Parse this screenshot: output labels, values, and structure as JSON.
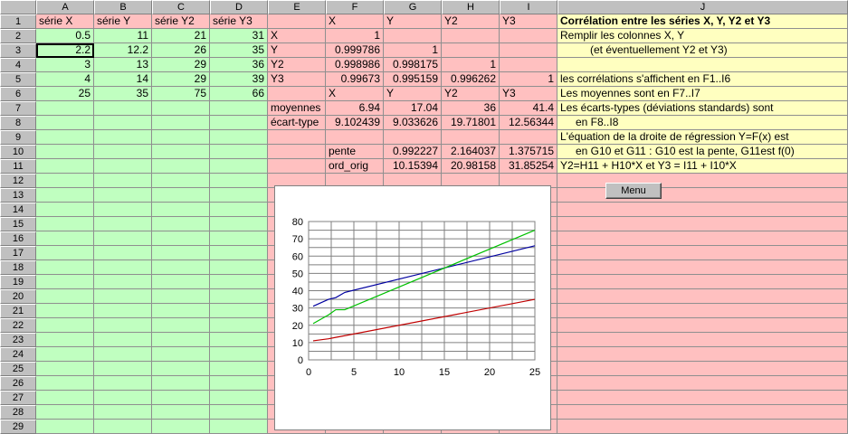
{
  "columns": [
    "A",
    "B",
    "C",
    "D",
    "E",
    "F",
    "G",
    "H",
    "I",
    "J"
  ],
  "rows": [
    "1",
    "2",
    "3",
    "4",
    "5",
    "6",
    "7",
    "8",
    "9",
    "10",
    "11",
    "12",
    "13",
    "14",
    "15",
    "16",
    "17",
    "18",
    "19",
    "20",
    "21",
    "22",
    "23",
    "24",
    "25",
    "26",
    "27",
    "28",
    "29"
  ],
  "cells": {
    "A1": "série X",
    "B1": "série Y",
    "C1": "série Y2",
    "D1": "série Y3",
    "A2": "0.5",
    "B2": "11",
    "C2": "21",
    "D2": "31",
    "A3": "2.2",
    "B3": "12.2",
    "C3": "26",
    "D3": "35",
    "A4": "3",
    "B4": "13",
    "C4": "29",
    "D4": "36",
    "A5": "4",
    "B5": "14",
    "C5": "29",
    "D5": "39",
    "A6": "25",
    "B6": "35",
    "C6": "75",
    "D6": "66",
    "E1": "",
    "F1": "X",
    "G1": "Y",
    "H1": "Y2",
    "I1": "Y3",
    "E2": "X",
    "F2": "1",
    "E3": "Y",
    "F3": "0.999786",
    "G3": "1",
    "E4": "Y2",
    "F4": "0.998986",
    "G4": "0.998175",
    "H4": "1",
    "E5": "Y3",
    "F5": "0.99673",
    "G5": "0.995159",
    "H5": "0.996262",
    "I5": "1",
    "F6": "X",
    "G6": "Y",
    "H6": "Y2",
    "I6": "Y3",
    "E7": "moyennes",
    "F7": "6.94",
    "G7": "17.04",
    "H7": "36",
    "I7": "41.4",
    "E8": "écart-type",
    "F8": "9.102439",
    "G8": "9.033626",
    "H8": "19.71801",
    "I8": "12.56344",
    "F10": "pente",
    "G10": "0.992227",
    "H10": "2.164037",
    "I10": "1.375715",
    "F11": "ord_orig",
    "G11": "10.15394",
    "H11": "20.98158",
    "I11": "31.85254",
    "J1": "Corrélation entre les séries X, Y, Y2 et Y3",
    "J2": "Remplir les colonnes X, Y",
    "J3": "(et éventuellement Y2 et Y3)",
    "J5": "les corrélations s'affichent en F1..I6",
    "J6": "Les moyennes sont en F7..I7",
    "J7": "Les écarts-types (déviations standards) sont",
    "J8": "en F8..I8",
    "J9": "L'équation de la droite de régression Y=F(x) est",
    "J10": "en G10 et G11 : G10 est la pente, G11est f(0)",
    "J11": "Y2=H11 + H10*X et Y3 = I11 + I10*X"
  },
  "menu_button_label": "Menu",
  "colors": {
    "green": "#c0ffc0",
    "pink": "#ffc0c0",
    "yellow": "#ffffc0",
    "series_y": "#0000a0",
    "series_y2": "#00c000",
    "series_y3": "#c00000"
  },
  "chart_data": {
    "type": "line",
    "xlim": [
      0,
      25
    ],
    "ylim": [
      0,
      80
    ],
    "xticks": [
      0,
      5,
      10,
      15,
      20,
      25
    ],
    "yticks": [
      0,
      10,
      20,
      30,
      40,
      50,
      60,
      70,
      80
    ],
    "grid": true,
    "series": [
      {
        "color": "#0000a0",
        "x": [
          0.5,
          2.2,
          3,
          4,
          25
        ],
        "y": [
          31,
          35,
          36,
          39,
          66
        ]
      },
      {
        "color": "#00c000",
        "x": [
          0.5,
          2.2,
          3,
          4,
          25
        ],
        "y": [
          21,
          26,
          29,
          29,
          75
        ]
      },
      {
        "color": "#c00000",
        "x": [
          0.5,
          2.2,
          3,
          4,
          25
        ],
        "y": [
          11,
          12.2,
          13,
          14,
          35
        ]
      }
    ]
  }
}
